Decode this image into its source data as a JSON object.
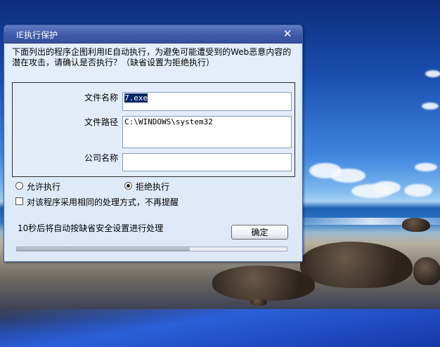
{
  "dialog": {
    "title": "IE执行保护",
    "prompt": "下面列出的程序企图利用IE自动执行，为避免可能遭受到的Web恶意内容的潜在攻击，请确认是否执行？（缺省设置为拒绝执行）",
    "fields": {
      "file_name_label": "文件名称",
      "file_name_value": "7.exe",
      "file_path_label": "文件路径",
      "file_path_value": "C:\\WINDOWS\\system32",
      "company_label": "公司名称",
      "company_value": ""
    },
    "options": {
      "allow_label": "允许执行",
      "deny_label": "拒绝执行",
      "selected": "deny",
      "remember_label": "对该程序采用相同的处理方式，不再提醒",
      "remember_checked": false
    },
    "countdown_text": "10秒后将自动按缺省安全设置进行处理",
    "ok_label": "确定",
    "countdown_progress_percent": 64
  }
}
